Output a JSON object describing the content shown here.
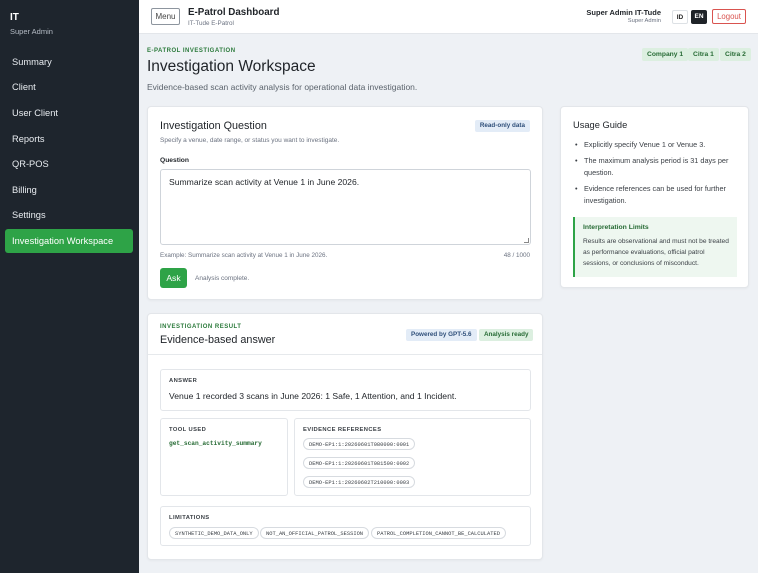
{
  "sidebar": {
    "brand": "IT",
    "role": "Super Admin",
    "items": [
      {
        "label": "Summary"
      },
      {
        "label": "Client"
      },
      {
        "label": "User Client"
      },
      {
        "label": "Reports"
      },
      {
        "label": "QR-POS"
      },
      {
        "label": "Billing"
      },
      {
        "label": "Settings"
      },
      {
        "label": "Investigation Workspace",
        "active": true
      }
    ]
  },
  "header": {
    "menu_label": "Menu",
    "title": "E-Patrol Dashboard",
    "subtitle": "IT-Tude E-Patrol",
    "user_name": "Super Admin IT-Tude",
    "user_role": "Super Admin",
    "lang_id": "ID",
    "lang_en": "EN",
    "logout_label": "Logout"
  },
  "page": {
    "eyebrow": "E-PATROL INVESTIGATION",
    "title": "Investigation Workspace",
    "description": "Evidence-based scan activity analysis for operational data investigation.",
    "badges": [
      "Company 1",
      "Citra 1",
      "Citra 2"
    ]
  },
  "question_card": {
    "title": "Investigation Question",
    "subtitle": "Specify a venue, date range, or status you want to investigate.",
    "readonly_badge": "Read-only data",
    "field_label": "Question",
    "value": "Summarize scan activity at Venue 1 in June 2026.",
    "example": "Example: Summarize scan activity at Venue 1 in June 2026.",
    "counter": "48 / 1000",
    "ask_label": "Ask",
    "status": "Analysis complete."
  },
  "result_card": {
    "eyebrow": "INVESTIGATION RESULT",
    "title": "Evidence-based answer",
    "powered_badge": "Powered by GPT-5.6",
    "ready_badge": "Analysis ready",
    "answer_label": "ANSWER",
    "answer": "Venue 1 recorded 3 scans in June 2026: 1 Safe, 1 Attention, and 1 Incident.",
    "tool_label": "TOOL USED",
    "tool": "get_scan_activity_summary",
    "evidence_label": "EVIDENCE REFERENCES",
    "evidence": [
      "DEMO-EP1:1:20260601T080000:0001",
      "DEMO-EP1:1:20260601T081500:0002",
      "DEMO-EP1:1:20260602T210000:0003"
    ],
    "limitations_label": "LIMITATIONS",
    "limitations": [
      "SYNTHETIC_DEMO_DATA_ONLY",
      "NOT_AN_OFFICIAL_PATROL_SESSION",
      "PATROL_COMPLETION_CANNOT_BE_CALCULATED"
    ]
  },
  "guide_card": {
    "title": "Usage Guide",
    "items": [
      "Explicitly specify Venue 1 or Venue 3.",
      "The maximum analysis period is 31 days per question.",
      "Evidence references can be used for further investigation."
    ],
    "limits_title": "Interpretation Limits",
    "limits_text": "Results are observational and must not be treated as performance evaluations, official patrol sessions, or conclusions of misconduct."
  },
  "colors": {
    "accent": "#2ea347",
    "sidebar_bg": "#1e252d",
    "danger": "#d9534f"
  }
}
